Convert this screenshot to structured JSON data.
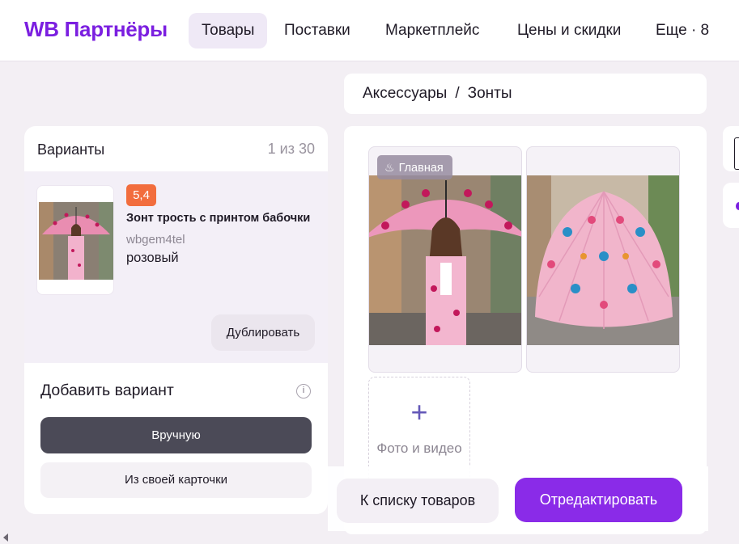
{
  "header": {
    "logo": "WB Партнёры",
    "nav": [
      {
        "label": "Товары",
        "active": true
      },
      {
        "label": "Поставки",
        "active": false
      },
      {
        "label": "Маркетплейс",
        "active": false
      },
      {
        "label": "Цены и скидки",
        "active": false
      },
      {
        "label": "Еще · 8",
        "active": false
      }
    ]
  },
  "breadcrumb": {
    "category": "Аксессуары",
    "separator": "/",
    "subcategory": "Зонты"
  },
  "variants": {
    "title": "Варианты",
    "count": "1 из 30",
    "item": {
      "rating": "5,4",
      "title": "Зонт трость с принтом бабочки",
      "sku": "wbgem4tel",
      "color": "розовый",
      "duplicate_label": "Дублировать"
    },
    "add_title": "Добавить вариант",
    "info_icon": "i",
    "manual_label": "Вручную",
    "from_card_label": "Из своей карточки"
  },
  "media": {
    "main_badge": "Главная",
    "add_photo_plus": "+",
    "add_photo_label": "Фото и видео"
  },
  "actions": {
    "back_label": "К списку товаров",
    "edit_label": "Отредактировать"
  },
  "colors": {
    "brand": "#7b1fe0",
    "edit_button": "#8a2be8",
    "rating_badge": "#f26d3d",
    "manual_button": "#4b4a57"
  }
}
